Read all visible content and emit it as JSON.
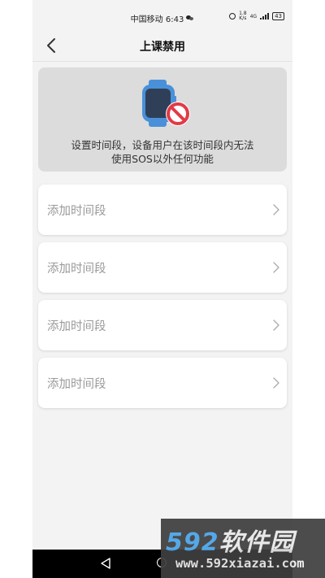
{
  "status_bar": {
    "carrier_time": "中国移动 6:43",
    "net_speed_top": "1.8",
    "net_speed_bottom": "K/s",
    "network": "4G",
    "battery": "43"
  },
  "header": {
    "title": "上课禁用"
  },
  "info_card": {
    "line1": "设置时间段，设备用户在该时间段内无法",
    "line2": "使用SOS以外任何功能"
  },
  "time_slots": [
    {
      "label": "添加时间段"
    },
    {
      "label": "添加时间段"
    },
    {
      "label": "添加时间段"
    },
    {
      "label": "添加时间段"
    }
  ],
  "watermark": {
    "logo_num": "592",
    "logo_cn": "软件园",
    "url": "www.592xiazai.com"
  },
  "colors": {
    "background": "#f3f3f3",
    "card_gray": "#dcdcdc",
    "watch_blue": "#4a90d9",
    "prohibit_red": "#e23a48",
    "placeholder_text": "#9a9a9a"
  }
}
